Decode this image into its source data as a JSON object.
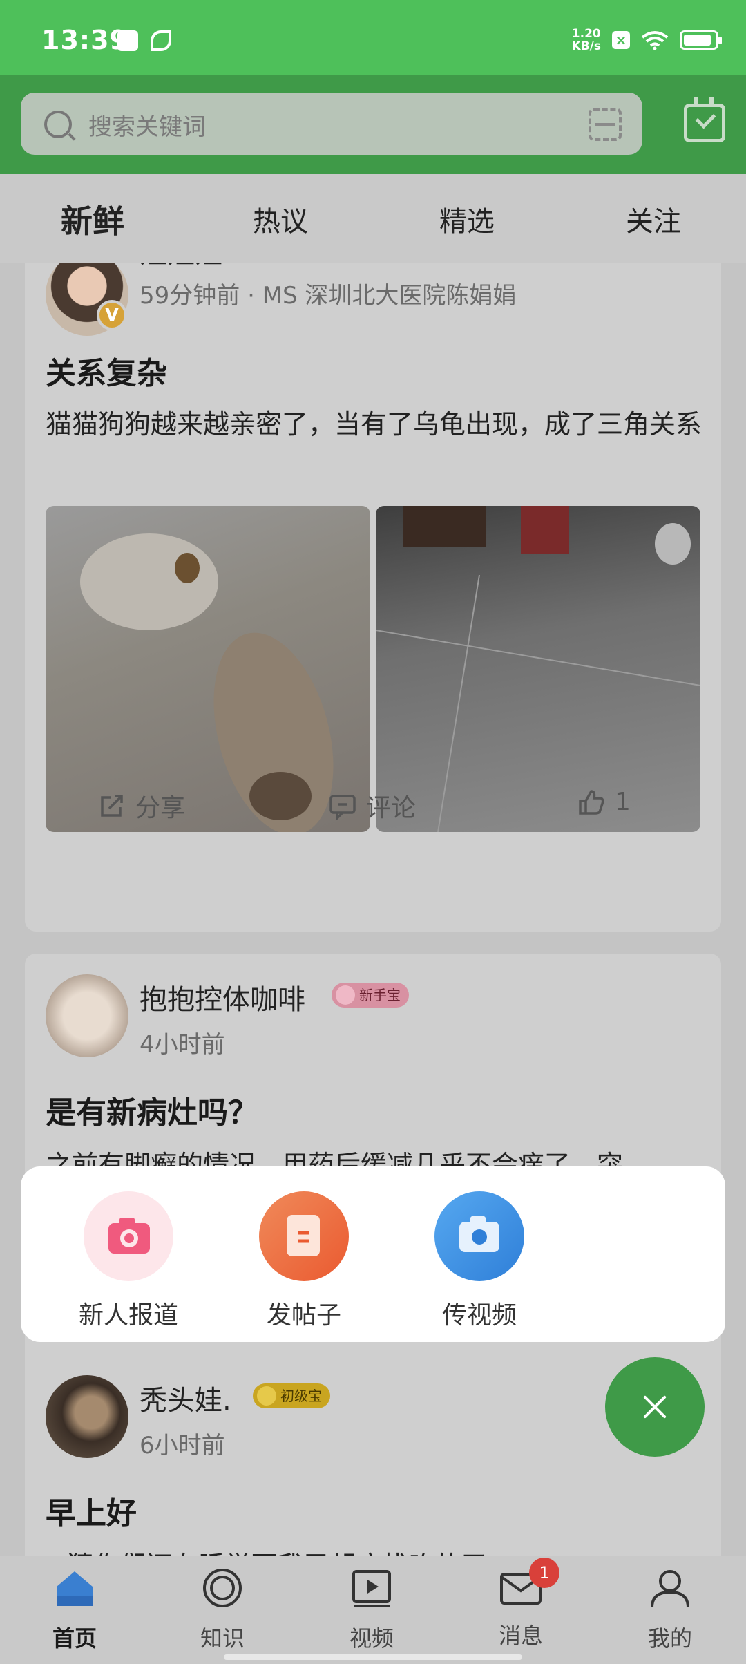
{
  "status_bar": {
    "time": "13:39",
    "net_speed_value": "1.20",
    "net_speed_unit": "KB/s"
  },
  "search": {
    "placeholder": "搜索关键词"
  },
  "tabs": [
    {
      "label": "新鲜",
      "active": true
    },
    {
      "label": "热议",
      "active": false
    },
    {
      "label": "精选",
      "active": false
    },
    {
      "label": "关注",
      "active": false
    }
  ],
  "posts": [
    {
      "username": "姐姐姐",
      "meta": "59分钟前 · MS 深圳北大医院陈娟娟",
      "title": "关系复杂",
      "body": "猫猫狗狗越来越亲密了，当有了乌龟出现，成了三角关系",
      "actions": {
        "share": "分享",
        "comment": "评论",
        "like_count": "1"
      }
    },
    {
      "username": "抱抱控体咖啡",
      "level_badge": "新手宝",
      "meta": "4小时前",
      "title": "是有新病灶吗？",
      "body": "之前有脚癣的情况，用药后缓减几乎不会痒了，突"
    },
    {
      "username": "秃头娃.",
      "level_badge": "初级宝",
      "meta": "6小时前",
      "title": "早上好",
      "body": "~猜你们还在睡觉而我已起床找吃的了"
    }
  ],
  "popup": {
    "items": [
      {
        "label": "新人报道",
        "icon": "camera-icon",
        "color": "#f05a7e"
      },
      {
        "label": "发帖子",
        "icon": "post-icon",
        "color": "#f06a40"
      },
      {
        "label": "传视频",
        "icon": "video-camera-icon",
        "color": "#3a8ee6"
      }
    ]
  },
  "bottom_nav": [
    {
      "label": "首页",
      "icon": "home-icon",
      "active": true
    },
    {
      "label": "知识",
      "icon": "knowledge-icon",
      "active": false
    },
    {
      "label": "视频",
      "icon": "video-icon",
      "active": false
    },
    {
      "label": "消息",
      "icon": "message-icon",
      "active": false,
      "badge": "1"
    },
    {
      "label": "我的",
      "icon": "profile-icon",
      "active": false
    }
  ],
  "colors": {
    "brand_green": "#4ec05a",
    "dark_green": "#3f9a48",
    "badge_red": "#d9403a"
  }
}
